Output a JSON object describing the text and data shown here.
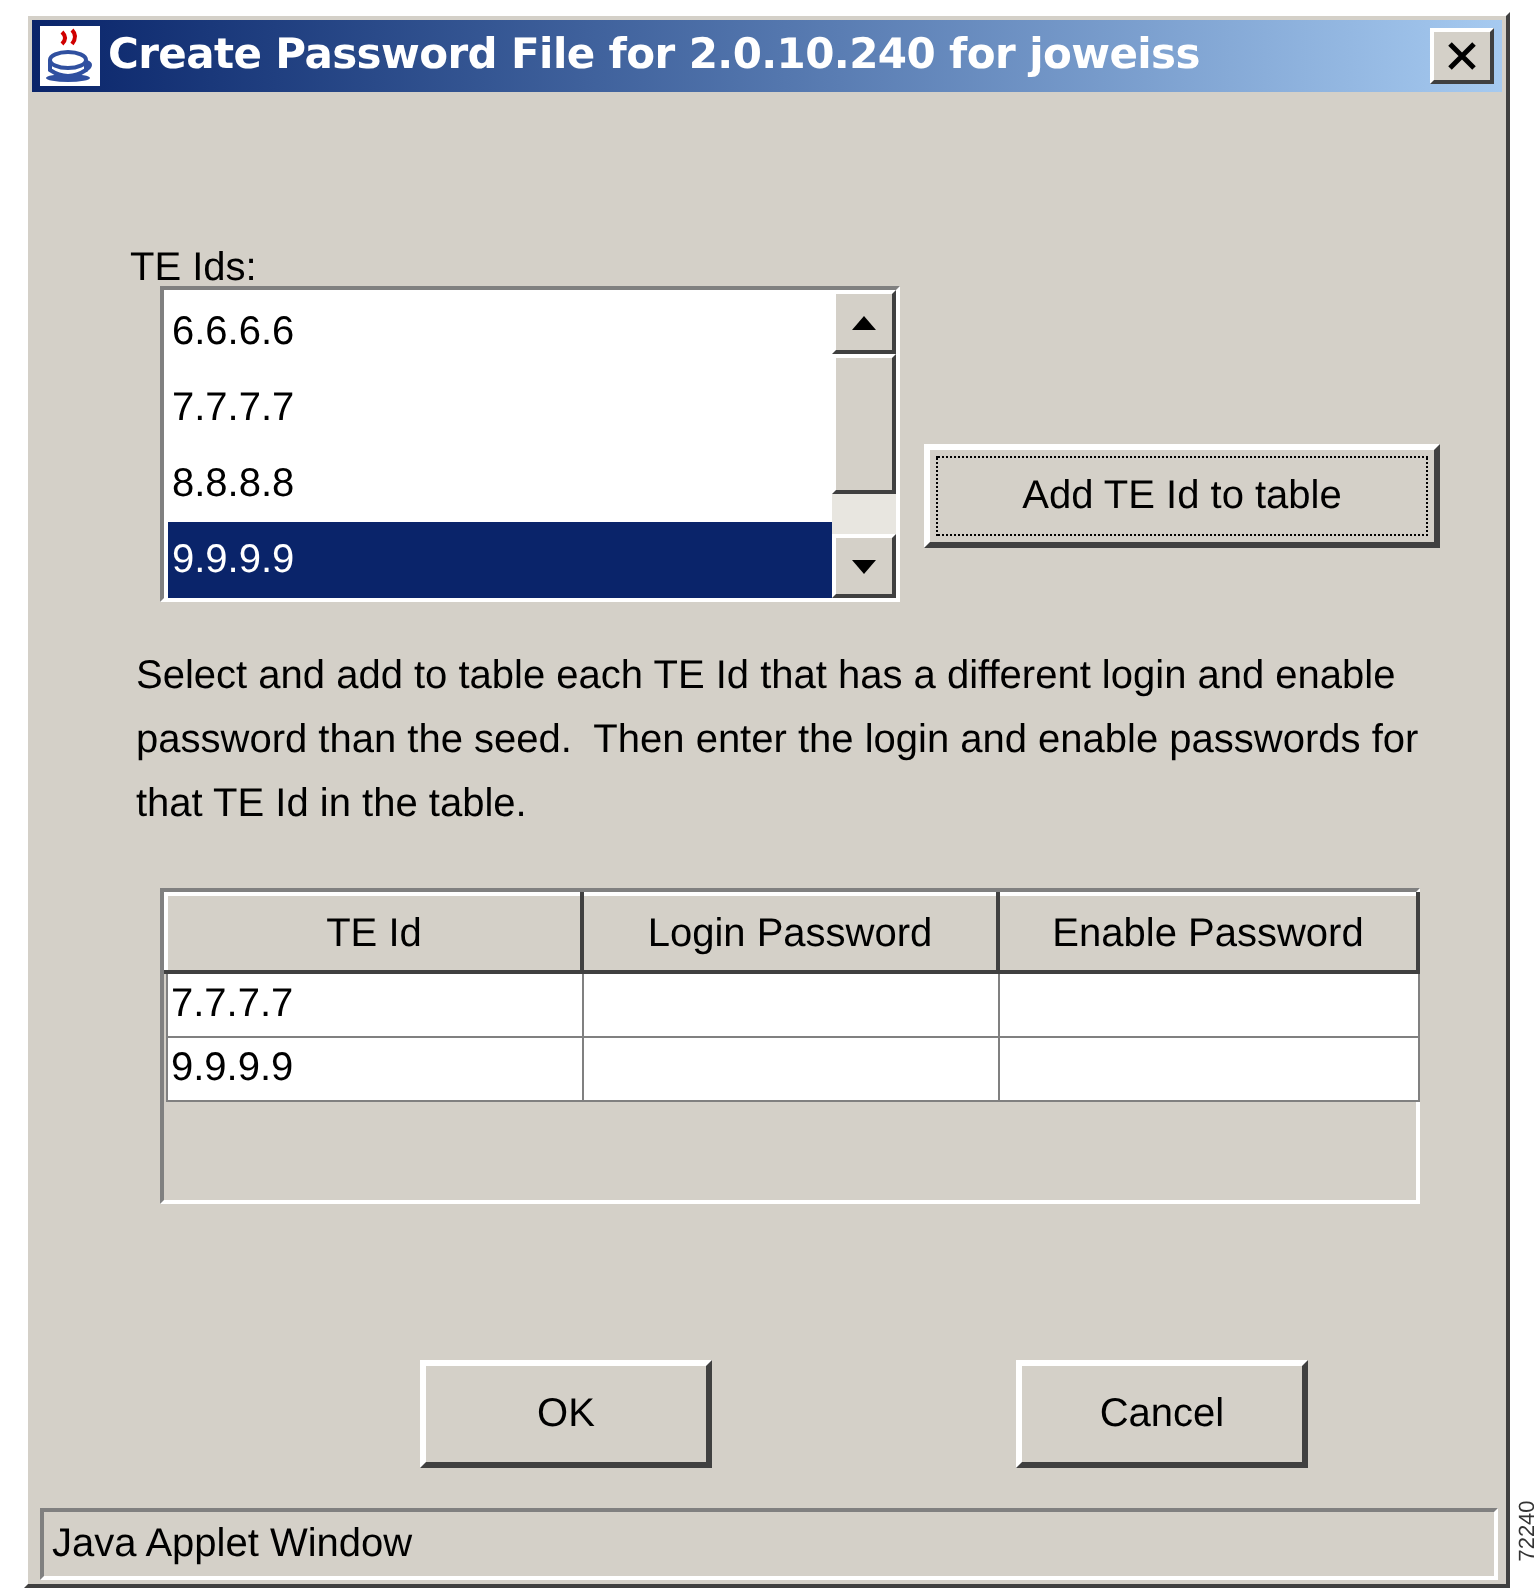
{
  "window": {
    "title": "Create Password File for 2.0.10.240 for joweiss"
  },
  "te_ids": {
    "label": "TE Ids:",
    "items": [
      {
        "text": "6.6.6.6",
        "selected": false
      },
      {
        "text": "7.7.7.7",
        "selected": false
      },
      {
        "text": "8.8.8.8",
        "selected": false
      },
      {
        "text": "9.9.9.9",
        "selected": true
      }
    ]
  },
  "add_button": "Add TE Id to table",
  "instructions": "Select and add to table each TE Id that has a different login and enable password than the seed.  Then enter the login and enable passwords for that TE Id in the table.",
  "table": {
    "columns": [
      "TE Id",
      "Login Password",
      "Enable Password"
    ],
    "rows": [
      [
        "7.7.7.7",
        "",
        ""
      ],
      [
        "9.9.9.9",
        "",
        ""
      ]
    ]
  },
  "buttons": [
    "OK",
    "Cancel"
  ],
  "status_bar": "Java Applet Window",
  "figure_number": "72240"
}
